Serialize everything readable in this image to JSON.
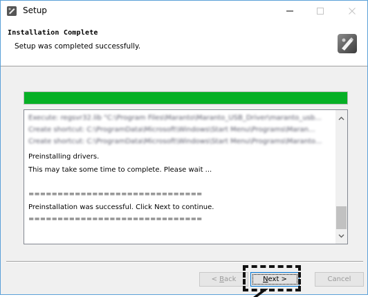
{
  "window": {
    "title": "Setup",
    "minimize_glyph": "—",
    "maximize_glyph": "☐",
    "close_glyph": "✕"
  },
  "header": {
    "title": "Installation Complete",
    "subtitle": "Setup was completed successfully.",
    "icon": "installer-disk-icon"
  },
  "progress": {
    "percent": 100,
    "color": "#06b025"
  },
  "log": {
    "blurred_lines": [
      "Execute: regsvr32.lib \"C:\\Program Files\\Maranto\\Maranto_USB_Driver\\maranto_usb...",
      "Create shortcut: C:\\ProgramData\\Microsoft\\Windows\\Start Menu\\Programs\\Maran...",
      "Create shortcut: C:\\ProgramData\\Microsoft\\Windows\\Start Menu\\Programs\\Maranto..."
    ],
    "lines": [
      "Preinstalling drivers.",
      "This may take some time to complete. Please wait ...",
      "",
      "==============================",
      "Preinstallation was successful. Click Next to continue.",
      "=============================="
    ],
    "scroll_up_icon": "scroll-up-arrow",
    "scroll_down_icon": "scroll-down-arrow"
  },
  "buttons": {
    "back_prefix": "< ",
    "back_accel": "B",
    "back_rest": "ack",
    "next_accel": "N",
    "next_rest": "ext >",
    "cancel": "Cancel"
  },
  "colors": {
    "accent": "#0078d7",
    "progress": "#06b025"
  }
}
